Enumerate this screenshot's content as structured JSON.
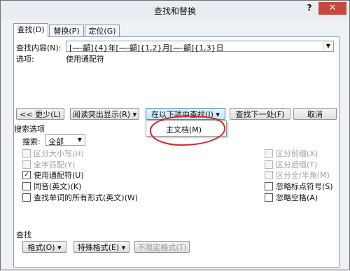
{
  "window": {
    "title": "查找和替换",
    "help": "?",
    "close": "✕"
  },
  "tabs": [
    {
      "label": "查找(D)",
      "active": true
    },
    {
      "label": "替换(P)",
      "active": false
    },
    {
      "label": "定位(G)",
      "active": false
    }
  ],
  "find": {
    "label": "查找内容(N):",
    "value": "[—-龥]{4}年[—-龥]{1,2}月[—-龥]{1,3}日",
    "options_label": "选项:",
    "options_value": "使用通配符"
  },
  "buttons": {
    "less": "<< 更少(L)",
    "reading_highlight": "阅读突出显示(R) ▾",
    "find_in": "在以下项中查找(I) ▾",
    "find_next": "查找下一处(F)",
    "cancel": "取消"
  },
  "find_in_menu": {
    "items": [
      "主文档(M)"
    ]
  },
  "search_options": {
    "heading": "搜索选项",
    "search_label": "搜索:",
    "search_value": "全部",
    "left": [
      {
        "label": "区分大小写(H)",
        "checked": false,
        "enabled": false
      },
      {
        "label": "全字匹配(Y)",
        "checked": false,
        "enabled": false
      },
      {
        "label": "使用通配符(U)",
        "checked": true,
        "enabled": true
      },
      {
        "label": "同音(英文)(K)",
        "checked": false,
        "enabled": true
      },
      {
        "label": "查找单词的所有形式(英文)(W)",
        "checked": false,
        "enabled": true
      }
    ],
    "right": [
      {
        "label": "区分前缀(X)",
        "checked": false,
        "enabled": false
      },
      {
        "label": "区分后缀(T)",
        "checked": false,
        "enabled": false
      },
      {
        "label": "区分全/半角(M)",
        "checked": false,
        "enabled": false
      },
      {
        "label": "忽略标点符号(S)",
        "checked": false,
        "enabled": true
      },
      {
        "label": "忽略空格(A)",
        "checked": false,
        "enabled": true
      }
    ]
  },
  "footer": {
    "heading": "查找",
    "format": "格式(O) ▾",
    "special": "特殊格式(E) ▾",
    "no_format": "不限定格式(T)"
  },
  "colors": {
    "annotation": "#d42a2a",
    "accent": "#3c7fb1"
  }
}
